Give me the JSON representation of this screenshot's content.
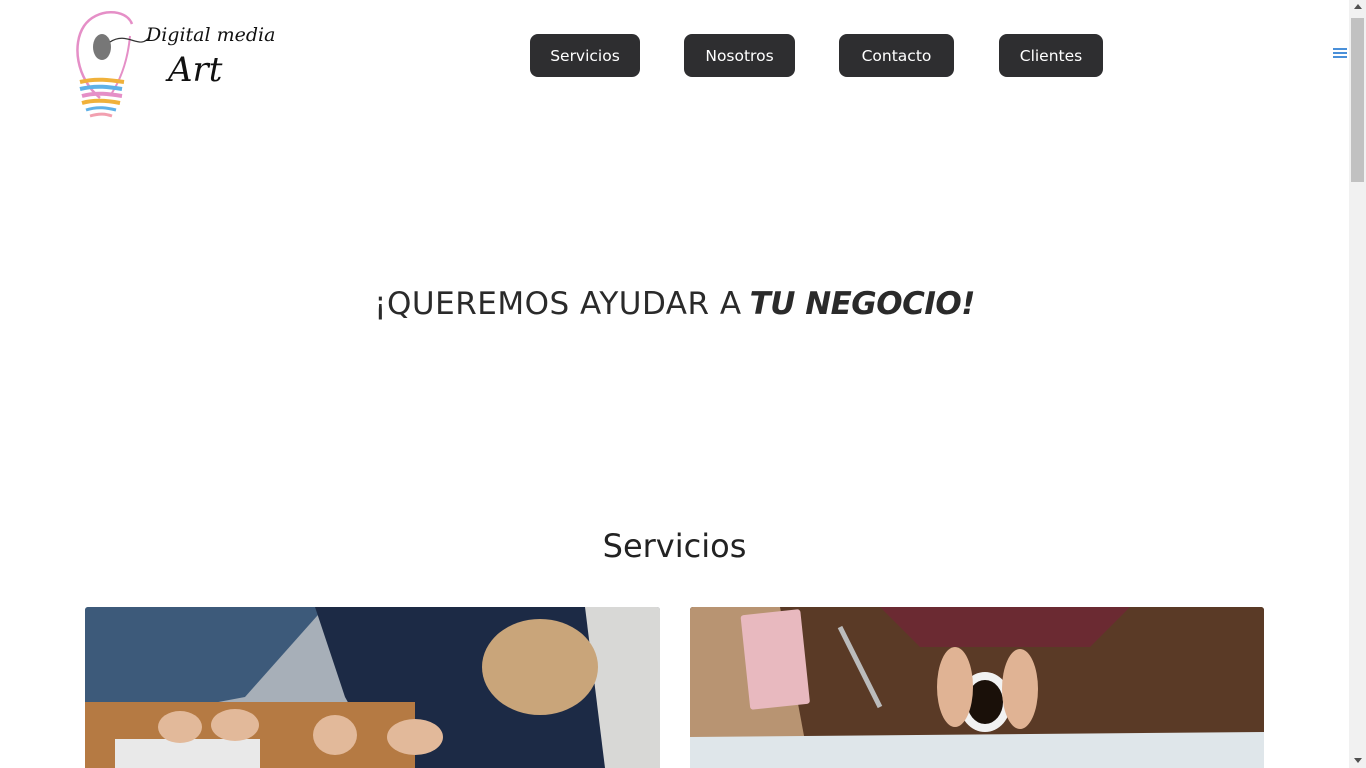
{
  "header": {
    "logo": {
      "line1": "Digital media",
      "line2": "Art"
    },
    "nav": [
      {
        "label": "Servicios"
      },
      {
        "label": "Nosotros"
      },
      {
        "label": "Contacto"
      },
      {
        "label": "Clientes"
      }
    ],
    "menu_icon": "hamburger-icon"
  },
  "hero": {
    "text_plain": "¡QUEREMOS AYUDAR A",
    "text_emphasis": "TU NEGOCIO!"
  },
  "services": {
    "title": "Servicios",
    "cards": [
      {
        "image": "people-working-laptop-photo"
      },
      {
        "image": "hands-coffee-map-photo"
      }
    ]
  },
  "colors": {
    "nav_button_bg": "#2e2e30",
    "nav_button_text": "#ffffff",
    "menu_icon": "#4a90d9",
    "text": "#222222"
  }
}
